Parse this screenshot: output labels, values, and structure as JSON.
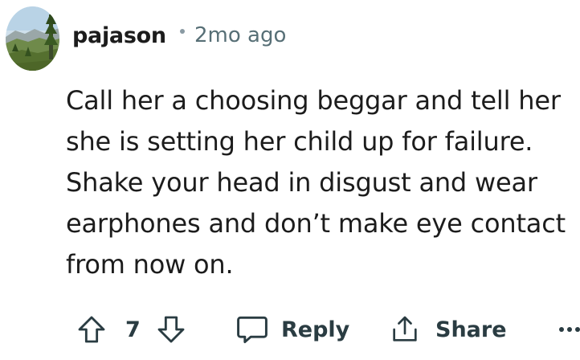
{
  "comment": {
    "author": "pajason",
    "separator": "•",
    "timestamp": "2mo ago",
    "body_lines": [
      "Call her a choosing beggar and tell her",
      "she is setting her child up for failure.",
      "Shake your head in disgust and wear",
      "earphones and don’t make eye contact",
      "from now on."
    ]
  },
  "actions": {
    "score": "7",
    "reply_label": "Reply",
    "share_label": "Share",
    "upvote_icon": "upvote-arrow-icon",
    "downvote_icon": "downvote-arrow-icon",
    "reply_icon": "speech-bubble-icon",
    "share_icon": "share-upload-icon",
    "more_icon": "ellipsis-icon"
  },
  "colors": {
    "text": "#1c1c1c",
    "meta": "#576f76",
    "action": "#2a3c42",
    "background": "#ffffff"
  }
}
